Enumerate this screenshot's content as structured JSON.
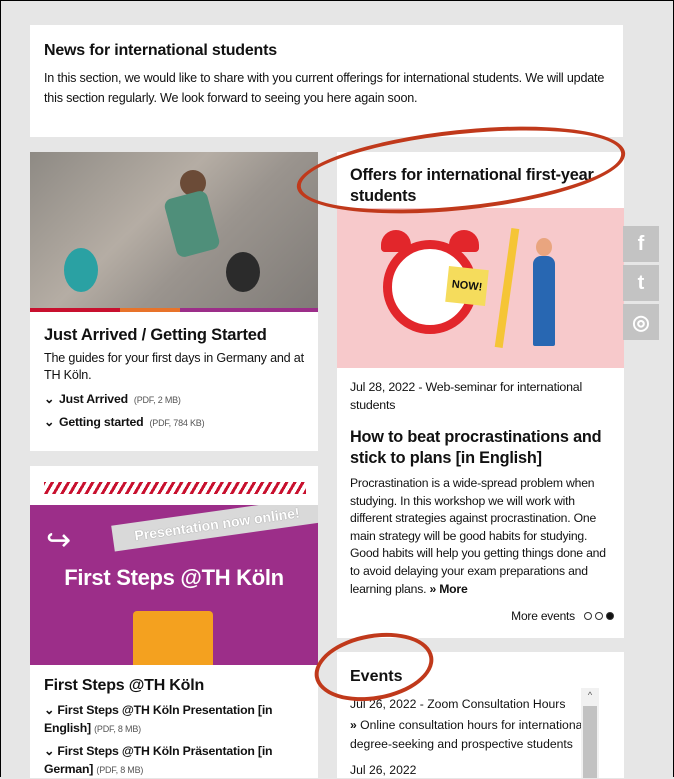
{
  "news": {
    "title": "News for international students",
    "text": "In this section, we would like to share with you current offerings for international students. We will update this section regularly. We look forward to seeing you here again soon."
  },
  "arrived": {
    "title": "Just Arrived / Getting Started",
    "desc": "The guides for your first days in Germany and at TH Köln.",
    "links": [
      {
        "label": "Just Arrived",
        "meta": "(PDF, 2 MB)"
      },
      {
        "label": "Getting started",
        "meta": "(PDF, 784 KB)"
      }
    ]
  },
  "steps": {
    "banner": "Presentation now online!",
    "promo_title": "First Steps @TH Köln",
    "title": "First Steps @TH Köln",
    "links": [
      {
        "label": "First Steps @TH Köln Presentation [in English]",
        "meta": "(PDF, 8 MB)"
      },
      {
        "label": "First Steps @TH Köln Präsentation [in German]",
        "meta": "(PDF, 8 MB)"
      }
    ]
  },
  "offers": {
    "title": "Offers for international first-year students",
    "note": "NOW!",
    "date": "Jul 28, 2022 - Web-seminar for international students",
    "headline": "How to beat procrastinations and stick to plans [in English]",
    "body": "Procrastination is a wide-spread problem when studying. In this workshop we will work with different strategies against procrastination. One main strategy will be good habits for studying. Good habits will help you getting things done and to avoid delaying your exam preparations and learning plans.",
    "more": "More",
    "more_events": "More events"
  },
  "events": {
    "title": "Events",
    "item1": "Jul 26, 2022 - Zoom Consultation Hours",
    "item1_link": "Online consultation hours for international degree-seeking and prospective students",
    "item2": "Jul 26, 2022"
  },
  "social": {
    "facebook": "f",
    "twitter": "t",
    "instagram": "◎"
  },
  "colors": {
    "accent": "#c8102e",
    "callout": "#c0391b",
    "promo": "#9c2e89"
  }
}
